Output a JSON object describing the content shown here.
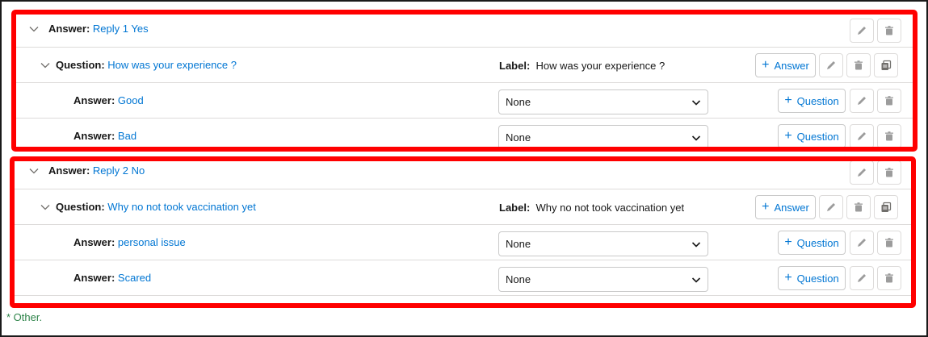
{
  "groups": [
    {
      "answer": {
        "label": "Answer:",
        "value": "Reply 1 Yes"
      },
      "question": {
        "label": "Question:",
        "value": "How was your experience ?",
        "label_caption": "Label:",
        "label_value": "How was your experience ?",
        "add_answer": "Answer"
      },
      "answers": [
        {
          "label": "Answer:",
          "value": "Good",
          "select": "None",
          "add_question": "Question"
        },
        {
          "label": "Answer:",
          "value": "Bad",
          "select": "None",
          "add_question": "Question"
        }
      ]
    },
    {
      "answer": {
        "label": "Answer:",
        "value": "Reply 2 No"
      },
      "question": {
        "label": "Question:",
        "value": "Why no not took vaccination yet",
        "label_caption": "Label:",
        "label_value": "Why no not took vaccination yet",
        "add_answer": "Answer"
      },
      "answers": [
        {
          "label": "Answer:",
          "value": "personal issue",
          "select": "None",
          "add_question": "Question"
        },
        {
          "label": "Answer:",
          "value": "Scared",
          "select": "None",
          "add_question": "Question"
        }
      ]
    }
  ],
  "footer_note": "* Other.",
  "icons": {
    "chevron": "chevron-down-icon",
    "edit": "pencil-icon",
    "delete": "trash-icon",
    "clone": "copy-icon",
    "add": "plus-icon"
  },
  "colors": {
    "link": "#0176d3",
    "highlight": "#ff0000",
    "note": "#2e844a"
  }
}
